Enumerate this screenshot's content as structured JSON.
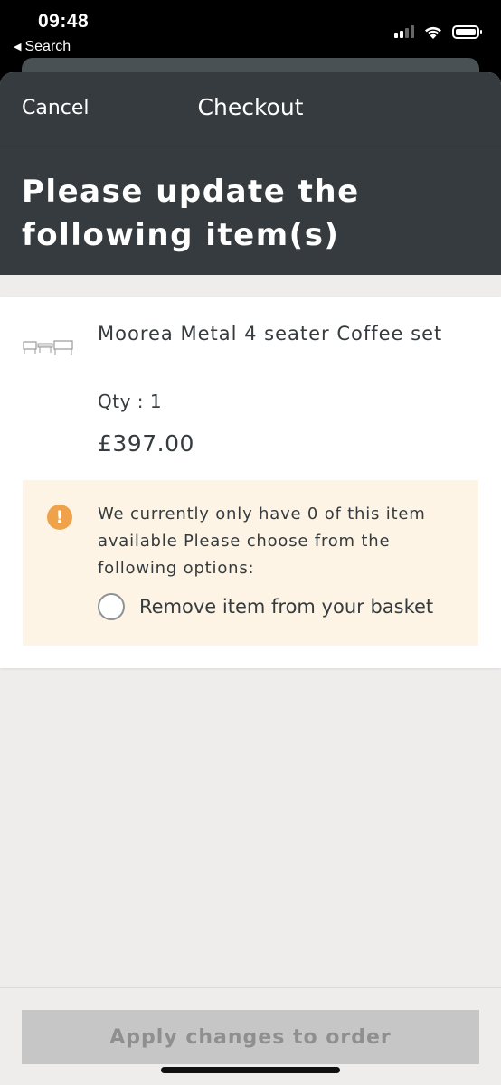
{
  "status_bar": {
    "time": "09:48",
    "back_label": "Search",
    "signal_icon": "signal-icon",
    "wifi_icon": "wifi-icon",
    "battery_icon": "battery-icon"
  },
  "navbar": {
    "cancel_label": "Cancel",
    "title": "Checkout"
  },
  "banner": {
    "title": "Please update the following item(s)"
  },
  "item": {
    "name": "Moorea Metal 4 seater Coffee set",
    "qty": "Qty : 1",
    "price": "£397.00",
    "thumb_icon": "product-thumbnail"
  },
  "warning": {
    "icon": "exclamation-icon",
    "message": "We currently only have 0 of this item available Please choose from the following options:",
    "options": [
      {
        "label": "Remove item from your basket",
        "selected": false
      }
    ]
  },
  "footer": {
    "apply_label": "Apply changes to order",
    "apply_enabled": false
  },
  "colors": {
    "header": "#353b3e",
    "warning_bg": "#fdf4e6",
    "warning_icon": "#f0a24a",
    "page_bg": "#efedec",
    "button_disabled": "#c6c6c6"
  }
}
